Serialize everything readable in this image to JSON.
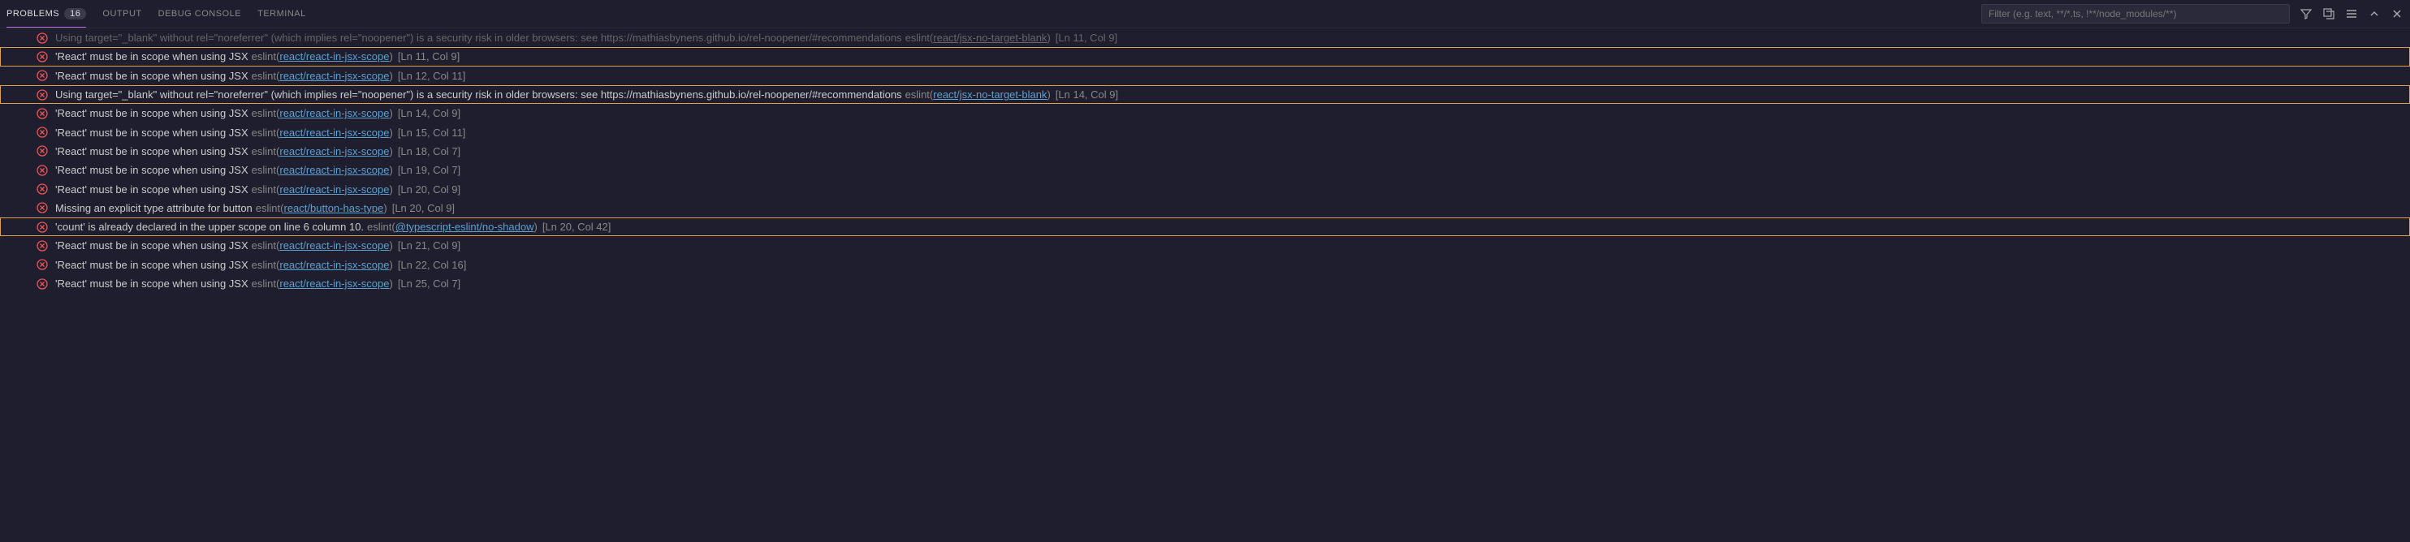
{
  "tabs": {
    "problems": "PROBLEMS",
    "problems_count": "16",
    "output": "OUTPUT",
    "debug_console": "DEBUG CONSOLE",
    "terminal": "TERMINAL"
  },
  "filter_placeholder": "Filter (e.g. text, **/*.ts, !**/node_modules/**)",
  "source_label": "eslint",
  "problems": [
    {
      "message": "Using target=\"_blank\" without rel=\"noreferrer\" (which implies rel=\"noopener\") is a security risk in older browsers: see https://mathiasbynens.github.io/rel-noopener/#recommendations",
      "rule": "react/jsx-no-target-blank",
      "location": "[Ln 11, Col 9]",
      "highlighted": false,
      "cutoff": true
    },
    {
      "message": "'React' must be in scope when using JSX",
      "rule": "react/react-in-jsx-scope",
      "location": "[Ln 11, Col 9]",
      "highlighted": true,
      "cutoff": false
    },
    {
      "message": "'React' must be in scope when using JSX",
      "rule": "react/react-in-jsx-scope",
      "location": "[Ln 12, Col 11]",
      "highlighted": false,
      "cutoff": false
    },
    {
      "message": "Using target=\"_blank\" without rel=\"noreferrer\" (which implies rel=\"noopener\") is a security risk in older browsers: see https://mathiasbynens.github.io/rel-noopener/#recommendations",
      "rule": "react/jsx-no-target-blank",
      "location": "[Ln 14, Col 9]",
      "highlighted": true,
      "cutoff": false
    },
    {
      "message": "'React' must be in scope when using JSX",
      "rule": "react/react-in-jsx-scope",
      "location": "[Ln 14, Col 9]",
      "highlighted": false,
      "cutoff": false
    },
    {
      "message": "'React' must be in scope when using JSX",
      "rule": "react/react-in-jsx-scope",
      "location": "[Ln 15, Col 11]",
      "highlighted": false,
      "cutoff": false
    },
    {
      "message": "'React' must be in scope when using JSX",
      "rule": "react/react-in-jsx-scope",
      "location": "[Ln 18, Col 7]",
      "highlighted": false,
      "cutoff": false
    },
    {
      "message": "'React' must be in scope when using JSX",
      "rule": "react/react-in-jsx-scope",
      "location": "[Ln 19, Col 7]",
      "highlighted": false,
      "cutoff": false
    },
    {
      "message": "'React' must be in scope when using JSX",
      "rule": "react/react-in-jsx-scope",
      "location": "[Ln 20, Col 9]",
      "highlighted": false,
      "cutoff": false
    },
    {
      "message": "Missing an explicit type attribute for button",
      "rule": "react/button-has-type",
      "location": "[Ln 20, Col 9]",
      "highlighted": false,
      "cutoff": false
    },
    {
      "message": "'count' is already declared in the upper scope on line 6 column 10.",
      "rule": "@typescript-eslint/no-shadow",
      "location": "[Ln 20, Col 42]",
      "highlighted": true,
      "cutoff": false
    },
    {
      "message": "'React' must be in scope when using JSX",
      "rule": "react/react-in-jsx-scope",
      "location": "[Ln 21, Col 9]",
      "highlighted": false,
      "cutoff": false
    },
    {
      "message": "'React' must be in scope when using JSX",
      "rule": "react/react-in-jsx-scope",
      "location": "[Ln 22, Col 16]",
      "highlighted": false,
      "cutoff": false
    },
    {
      "message": "'React' must be in scope when using JSX",
      "rule": "react/react-in-jsx-scope",
      "location": "[Ln 25, Col 7]",
      "highlighted": false,
      "cutoff": false
    }
  ]
}
